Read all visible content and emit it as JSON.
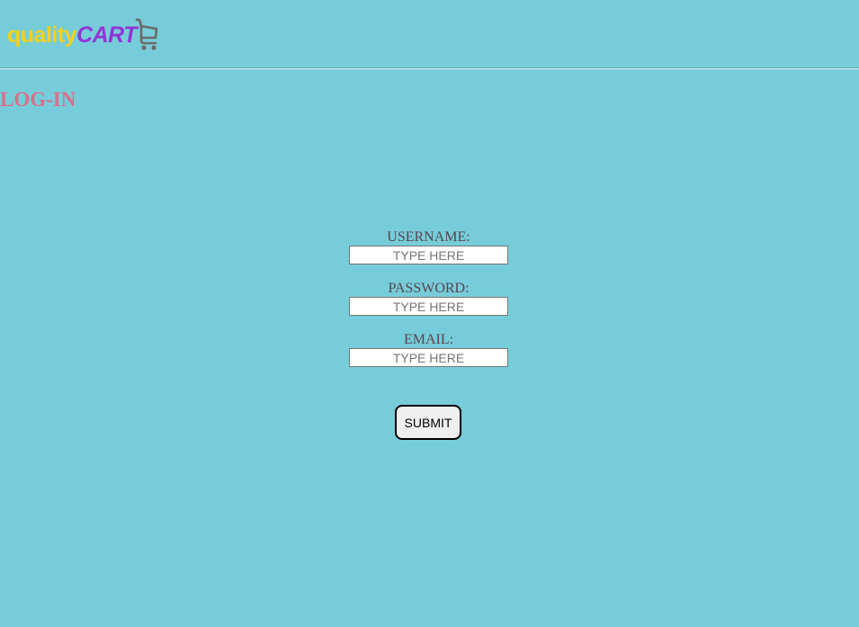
{
  "header": {
    "logo": {
      "part1": "quality",
      "part2": "CART",
      "icon": "shopping-cart-icon",
      "colors": {
        "quality": "#F4D11E",
        "cart": "#9234D6",
        "icon": "#6B6B6B"
      }
    }
  },
  "page": {
    "title": "LOG-IN",
    "background": "#76CDD9",
    "title_color": "#DB6E8C"
  },
  "form": {
    "fields": [
      {
        "label": "USERNAME:",
        "value": "",
        "placeholder": "TYPE HERE"
      },
      {
        "label": "PASSWORD:",
        "value": "",
        "placeholder": "TYPE HERE"
      },
      {
        "label": "EMAIL:",
        "value": "",
        "placeholder": "TYPE HERE"
      }
    ],
    "submit_label": "SUBMIT"
  }
}
